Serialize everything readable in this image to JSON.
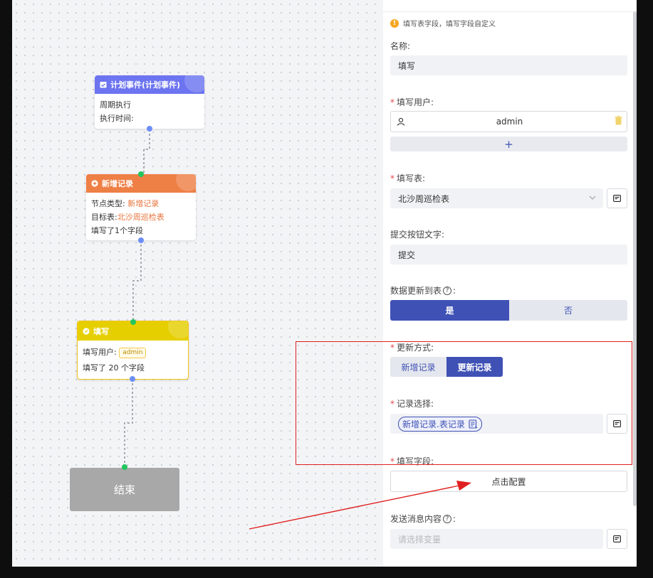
{
  "canvas": {
    "node_plan": {
      "title": "计划事件(计划事件)",
      "line1": "周期执行",
      "line2": "执行时间:"
    },
    "node_add": {
      "title": "新增记录",
      "type_label": "节点类型:",
      "type_value": "新增记录",
      "target_label": "目标表:",
      "target_value": "北沙周巡检表",
      "fields_text": "填写了1个字段"
    },
    "node_fill": {
      "title": "填写",
      "user_label": "填写用户:",
      "user_tag": "admin",
      "fields_text": "填写了 20 个字段"
    },
    "node_end": {
      "title": "结束"
    },
    "colors": {
      "plan": "#6c74f0",
      "add": "#ee7f45",
      "fill": "#e6cf00",
      "end": "#a8a8a8"
    }
  },
  "panel": {
    "hint": "填写表字段，填写字段自定义",
    "name_label": "名称:",
    "name_value": "填写",
    "user_label": "填写用户:",
    "user_value": "admin",
    "add_symbol": "+",
    "table_label": "填写表:",
    "table_value": "北沙周巡检表",
    "submit_label": "提交按钮文字:",
    "submit_value": "提交",
    "update_table_label": "数据更新到表",
    "update_yes": "是",
    "update_no": "否",
    "update_mode_label": "更新方式:",
    "mode_add": "新增记录",
    "mode_update": "更新记录",
    "record_label": "记录选择:",
    "record_tag": "新增记录.表记录",
    "fill_fields_label": "填写字段:",
    "config_button": "点击配置",
    "message_label": "发送消息内容",
    "message_placeholder": "请选择变量",
    "accent_color": "#3f51b5"
  }
}
